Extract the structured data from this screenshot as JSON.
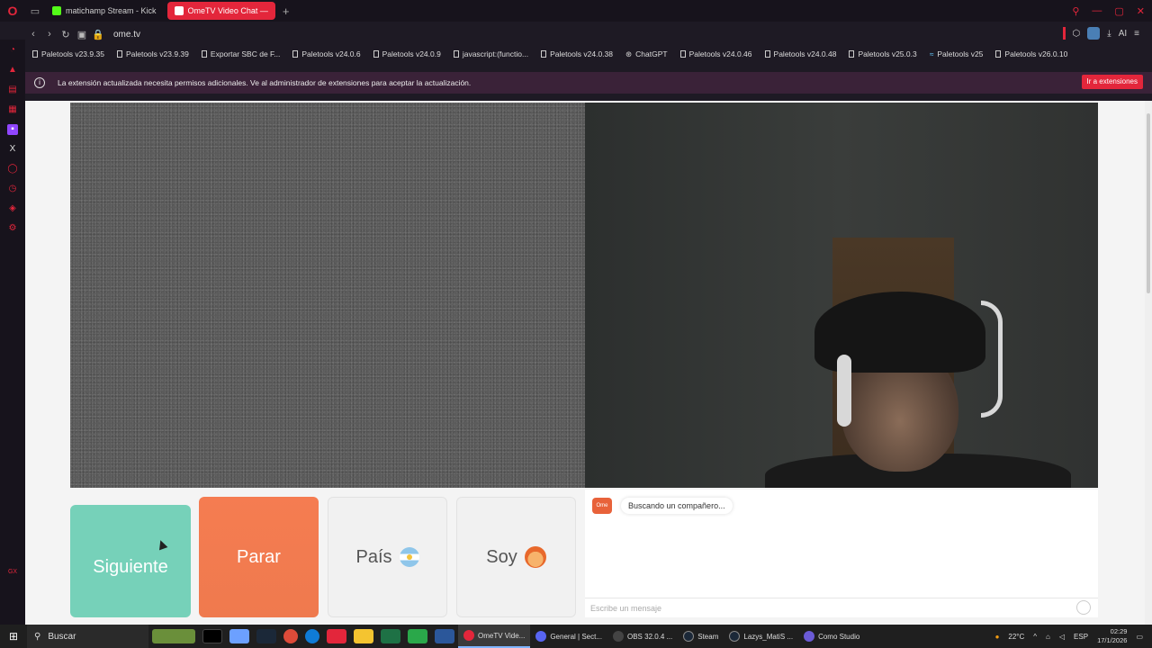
{
  "browser": {
    "tabs": [
      {
        "label": "matichamp Stream - Kick",
        "active": false,
        "color": "#53fc18"
      },
      {
        "label": "OmeTV Video Chat —",
        "active": true,
        "color": "#ffffff"
      }
    ],
    "url": "ome.tv",
    "ai_label": "AI"
  },
  "bookmarks": [
    "Paletools v23.9.35",
    "Paletools v23.9.39",
    "Exportar SBC de F...",
    "Paletools v24.0.6",
    "Paletools v24.0.9",
    "javascript:(functio...",
    "Paletools v24.0.38",
    "ChatGPT",
    "Paletools v24.0.46",
    "Paletools v24.0.48",
    "Paletools v25.0.3",
    "Paletools v25",
    "Paletools v26.0.10"
  ],
  "notice": {
    "text": "La extensión actualizada necesita permisos adicionales. Ve al administrador de extensiones para aceptar la actualización.",
    "button": "Ir a extensiones"
  },
  "controls": {
    "next": "Siguiente",
    "stop": "Parar",
    "country": "País",
    "soy": "Soy"
  },
  "chat": {
    "logo": "Ome TV",
    "status": "Buscando un compañero...",
    "placeholder": "Escribe un mensaje"
  },
  "taskbar": {
    "search": "Buscar",
    "items": [
      {
        "label": "OmeTV Vide...",
        "active": true,
        "color": "#e3263b"
      },
      {
        "label": "General | Sect...",
        "active": false,
        "color": "#5865f2"
      },
      {
        "label": "OBS 32.0.4 ...",
        "active": false,
        "color": "#444444"
      },
      {
        "label": "Steam",
        "active": false,
        "color": "#1b2838"
      },
      {
        "label": "Lazys_MatiS ...",
        "active": false,
        "color": "#1b2838"
      },
      {
        "label": "Como Studio",
        "active": false,
        "color": "#6b5bd6"
      }
    ],
    "weather": "22°C",
    "lang": "ESP",
    "time": "02:29",
    "date": "17/1/2026"
  }
}
